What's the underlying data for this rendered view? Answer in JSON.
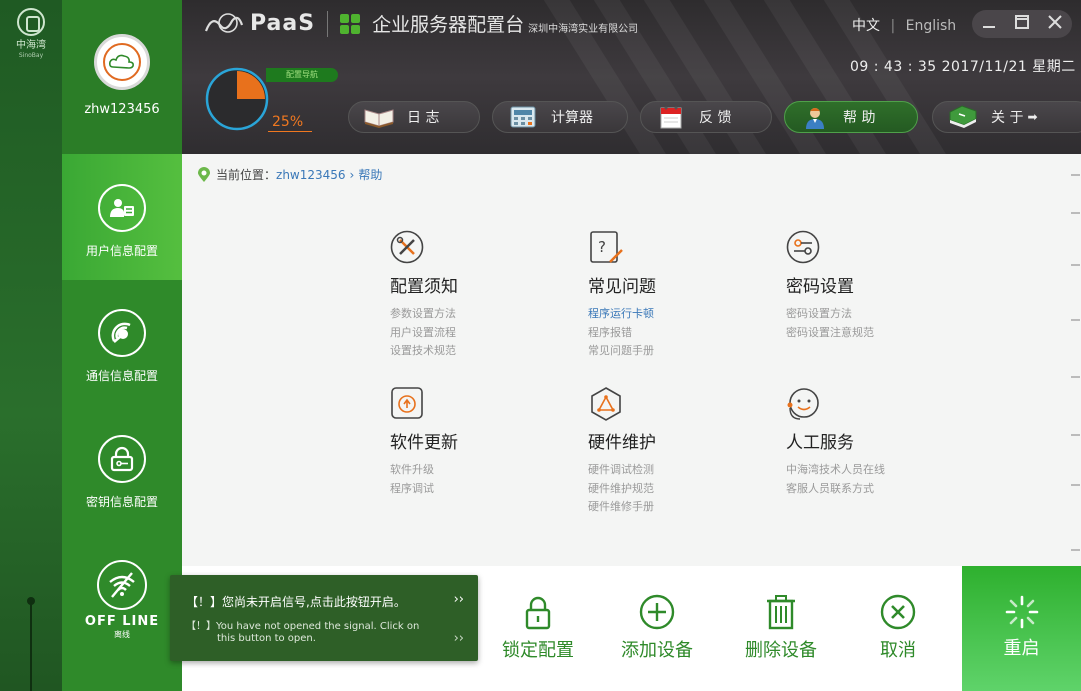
{
  "left_strip": {
    "logo_zh": "中海湾",
    "logo_en": "SinoBay"
  },
  "user": {
    "name": "zhw123456"
  },
  "nav": [
    {
      "label": "用户信息配置",
      "icon": "user-card-icon",
      "active": true
    },
    {
      "label": "通信信息配置",
      "icon": "signal-dish-icon",
      "active": false
    },
    {
      "label": "密钥信息配置",
      "icon": "lock-key-icon",
      "active": false
    }
  ],
  "status": {
    "label": "OFF LINE",
    "sublabel": "离线"
  },
  "header": {
    "brand": "PaaS",
    "title": "企业服务器配置台",
    "company": "深圳中海湾实业有限公司",
    "lang_zh": "中文",
    "lang_sep": "|",
    "lang_en": "English",
    "datetime": "09 : 43 : 35   2017/11/21   星期二",
    "nav_tag": "配置导航",
    "progress_label": "25%",
    "progress_value": 0.25,
    "toolbar": [
      {
        "label": "日 志",
        "icon": "open-book-icon"
      },
      {
        "label": "计算器",
        "icon": "calculator-icon"
      },
      {
        "label": "反 馈",
        "icon": "calendar-icon"
      },
      {
        "label": "帮 助",
        "icon": "support-agent-icon",
        "active": true
      },
      {
        "label": "关 于",
        "icon": "green-book-icon"
      }
    ],
    "toolbar_more": "➡"
  },
  "breadcrumb": {
    "prefix": "当前位置：",
    "user": "zhw123456",
    "sep": "›",
    "current": "帮助"
  },
  "cards": [
    {
      "title": "配置须知",
      "icon": "tools-icon",
      "items": [
        "参数设置方法",
        "用户设置流程",
        "设置技术规范"
      ]
    },
    {
      "title": "常见问题",
      "icon": "question-doc-icon",
      "items": [
        "程序运行卡顿",
        "程序报错",
        "常见问题手册"
      ],
      "highlight_index": 0
    },
    {
      "title": "密码设置",
      "icon": "password-icon",
      "items": [
        "密码设置方法",
        "密码设置注意规范"
      ]
    },
    {
      "title": "软件更新",
      "icon": "update-icon",
      "items": [
        "软件升级",
        "程序调试"
      ]
    },
    {
      "title": "硬件维护",
      "icon": "hardware-icon",
      "items": [
        "硬件调试检测",
        "硬件维护规范",
        "硬件维修手册"
      ]
    },
    {
      "title": "人工服务",
      "icon": "headset-icon",
      "items": [
        "中海湾技术人员在线",
        "客服人员联系方式"
      ]
    }
  ],
  "actions": [
    {
      "label": "锁定配置",
      "icon": "lock-icon"
    },
    {
      "label": "添加设备",
      "icon": "plus-circle-icon"
    },
    {
      "label": "删除设备",
      "icon": "trash-icon"
    },
    {
      "label": "取消",
      "icon": "x-circle-icon"
    }
  ],
  "restart": {
    "label": "重启",
    "icon": "spinner-icon"
  },
  "notice": {
    "zh": "【！】您尚未开启信号,点击此按钮开启。",
    "en_line1": "【！】You have not opened the signal. Click on",
    "en_line2": "this button to open.",
    "chevron": "››"
  },
  "colors": {
    "brand_green": "#2f8a2a",
    "accent_orange": "#f07820",
    "link_blue": "#3a78b8",
    "header_dark": "#2e2c2e"
  }
}
